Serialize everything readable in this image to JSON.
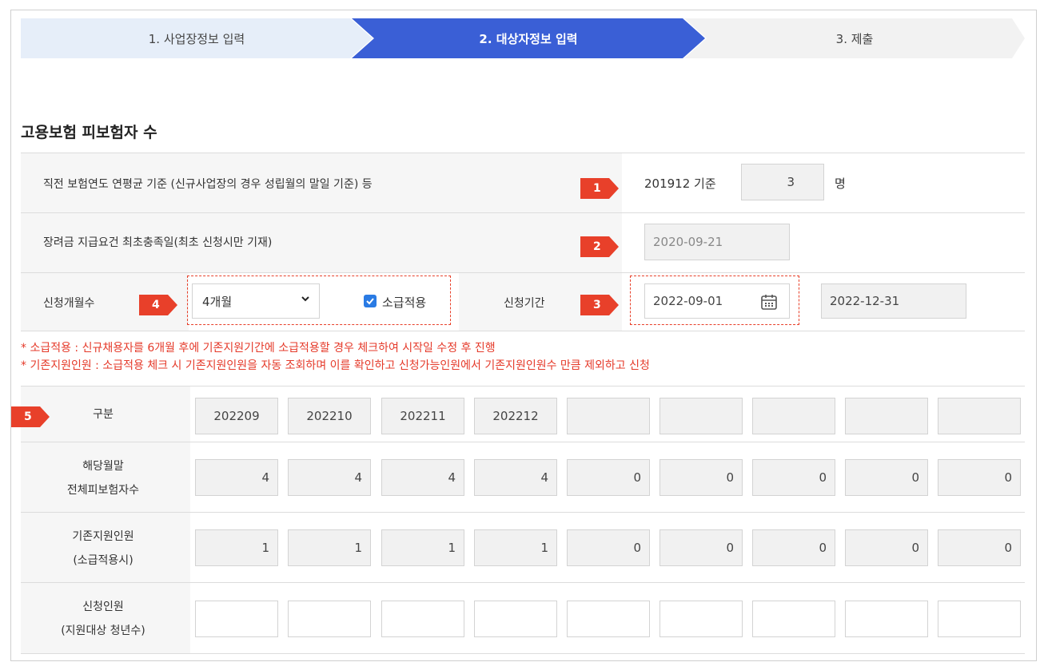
{
  "steps": [
    {
      "label": "1. 사업장정보 입력"
    },
    {
      "label": "2. 대상자정보 입력"
    },
    {
      "label": "3. 제출"
    }
  ],
  "section_title": "고용보험 피보험자 수",
  "row1": {
    "label": "직전 보험연도 연평균 기준 (신규사업장의 경우 성립월의 말일 기준) 등",
    "badge": "1",
    "base_text": "201912 기준",
    "count": "3",
    "unit": "명"
  },
  "row2": {
    "label": "장려금 지급요건 최초충족일(최초 신청시만 기재)",
    "badge": "2",
    "date": "2020-09-21"
  },
  "row3": {
    "months_label": "신청개월수",
    "badge4": "4",
    "months_value": "4개월",
    "retro_label": "소급적용",
    "retro_checked": true,
    "period_label": "신청기간",
    "badge3": "3",
    "start": "2022-09-01",
    "end": "2022-12-31"
  },
  "notes": [
    "* 소급적용 : 신규채용자를 6개월 후에 기존지원기간에 소급적용할 경우 체크하여 시작일 수정 후 진행",
    "* 기존지원인원 : 소급적용 체크 시 기존지원인원을 자동 조회하며 이를 확인하고 신청가능인원에서 기존지원인원수 만큼 제외하고 신청"
  ],
  "grid": {
    "badge": "5",
    "header_label": "구분",
    "months": [
      "202209",
      "202210",
      "202211",
      "202212",
      "",
      "",
      "",
      "",
      ""
    ],
    "total_label_1": "해당월말",
    "total_label_2": "전체피보험자수",
    "totals": [
      "4",
      "4",
      "4",
      "4",
      "0",
      "0",
      "0",
      "0",
      "0"
    ],
    "existing_label_1": "기존지원인원",
    "existing_label_2": "(소급적용시)",
    "existing": [
      "1",
      "1",
      "1",
      "1",
      "0",
      "0",
      "0",
      "0",
      "0"
    ],
    "apply_label_1": "신청인원",
    "apply_label_2": "(지원대상 청년수)",
    "apply": [
      "",
      "",
      "",
      "",
      "",
      "",
      "",
      "",
      ""
    ]
  },
  "colors": {
    "accent": "#3a5fd6",
    "badge": "#e8402a",
    "note": "#e53a2a"
  }
}
